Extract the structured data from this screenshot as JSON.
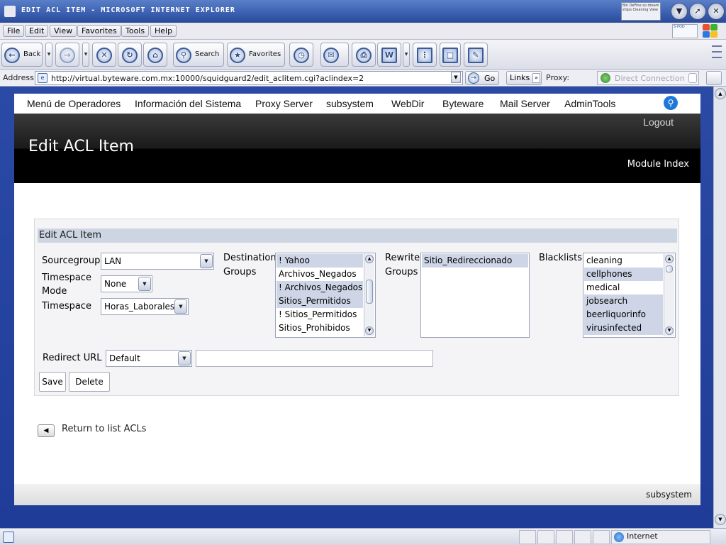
{
  "window": {
    "title": "Edit ACL Item - Microsoft Internet Explorer",
    "theme_info": "Bin DeFine so dream ships Cleaning View"
  },
  "menubar": {
    "items": [
      "File",
      "Edit",
      "View",
      "Favorites",
      "Tools",
      "Help"
    ],
    "brand": "S-POD"
  },
  "toolbar": {
    "back_label": "Back",
    "search_label": "Search",
    "favorites_label": "Favorites"
  },
  "addressbar": {
    "label": "Address",
    "url": "http://virtual.byteware.com.mx:10000/squidguard2/edit_aclitem.cgi?aclindex=2",
    "go_label": "Go",
    "links_label": "Links",
    "proxy_label": "Proxy:",
    "proxy_value": "Direct Connection"
  },
  "nav": {
    "items": [
      "Menú de Operadores",
      "Información del Sistema",
      "Proxy Server",
      "subsystem",
      "WebDir",
      "Byteware",
      "Mail Server",
      "AdminTools"
    ]
  },
  "header": {
    "logout": "Logout",
    "title": "Edit ACL Item",
    "module_index": "Module Index"
  },
  "form": {
    "panel_title": "Edit ACL Item",
    "sourcegroup_label": "Sourcegroup",
    "sourcegroup_value": "LAN",
    "timespace_mode_label": "Timespace Mode",
    "timespace_mode_value": "None",
    "timespace_label": "Timespace",
    "timespace_value": "Horas_Laborales",
    "destination_label": "Destination Groups",
    "destination_options": [
      {
        "text": "! Yahoo",
        "selected": true
      },
      {
        "text": "Archivos_Negados",
        "selected": false
      },
      {
        "text": "! Archivos_Negados",
        "selected": true
      },
      {
        "text": "Sitios_Permitidos",
        "selected": true
      },
      {
        "text": "! Sitios_Permitidos",
        "selected": false
      },
      {
        "text": "Sitios_Prohibidos",
        "selected": false
      }
    ],
    "rewrite_label": "Rewrite Groups",
    "rewrite_options": [
      {
        "text": "Sitio_Redireccionado",
        "selected": true
      }
    ],
    "blacklists_label": "Blacklists",
    "blacklist_options": [
      {
        "text": "cleaning",
        "selected": false
      },
      {
        "text": "cellphones",
        "selected": true
      },
      {
        "text": "medical",
        "selected": false
      },
      {
        "text": "jobsearch",
        "selected": true
      },
      {
        "text": "beerliquorinfo",
        "selected": true
      },
      {
        "text": "virusinfected",
        "selected": true
      }
    ],
    "redirect_label": "Redirect URL",
    "redirect_value": "Default",
    "redirect_text": "",
    "save_label": "Save",
    "delete_label": "Delete"
  },
  "return_link": "Return to list ACLs",
  "footer": {
    "text": "subsystem"
  },
  "statusbar": {
    "zone": "Internet"
  },
  "colors": {
    "selected_option": "#cdd5e6",
    "panel_head": "#cdd5e2",
    "desktop_blue": "#1e3c98"
  }
}
